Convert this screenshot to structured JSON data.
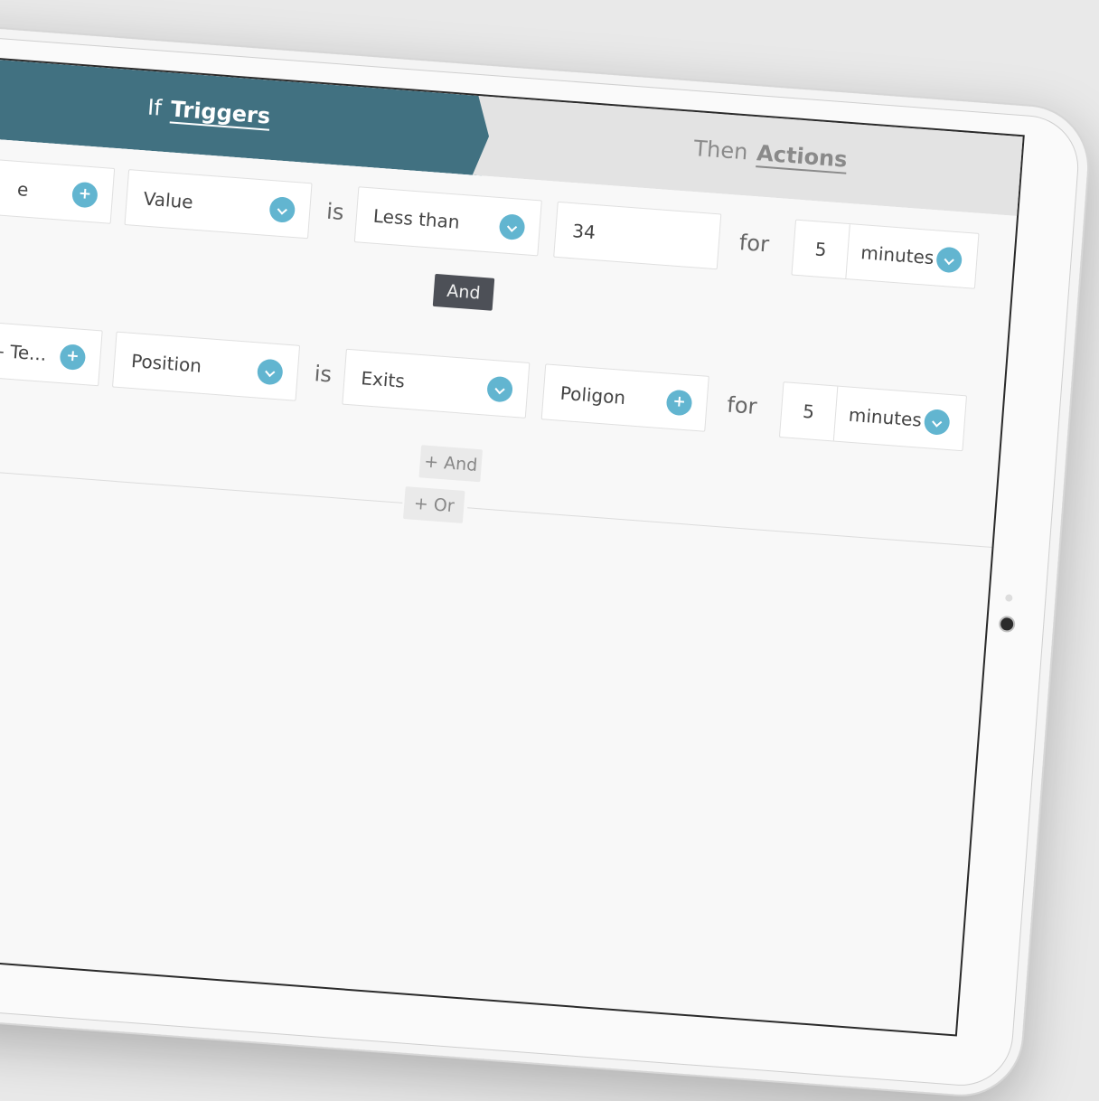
{
  "tabs": {
    "if_prefix": "If",
    "if_label": "Triggers",
    "then_prefix": "Then",
    "then_label": "Actions"
  },
  "row1": {
    "source_text": "e",
    "attribute": "Value",
    "is_label": "is",
    "operator": "Less than",
    "value": "34",
    "for_label": "for",
    "duration": "5",
    "unit": "minutes"
  },
  "and_connector": "And",
  "row2": {
    "source_text": "- Te...",
    "attribute": "Position",
    "is_label": "is",
    "operator": "Exits",
    "value": "Poligon",
    "for_label": "for",
    "duration": "5",
    "unit": "minutes"
  },
  "add_and": "+ And",
  "add_or": "+ Or",
  "colors": {
    "if_tab": "#417181",
    "then_tab": "#e3e3e3",
    "accent_circle": "#62b5d0",
    "and_pill": "#4d5057"
  }
}
